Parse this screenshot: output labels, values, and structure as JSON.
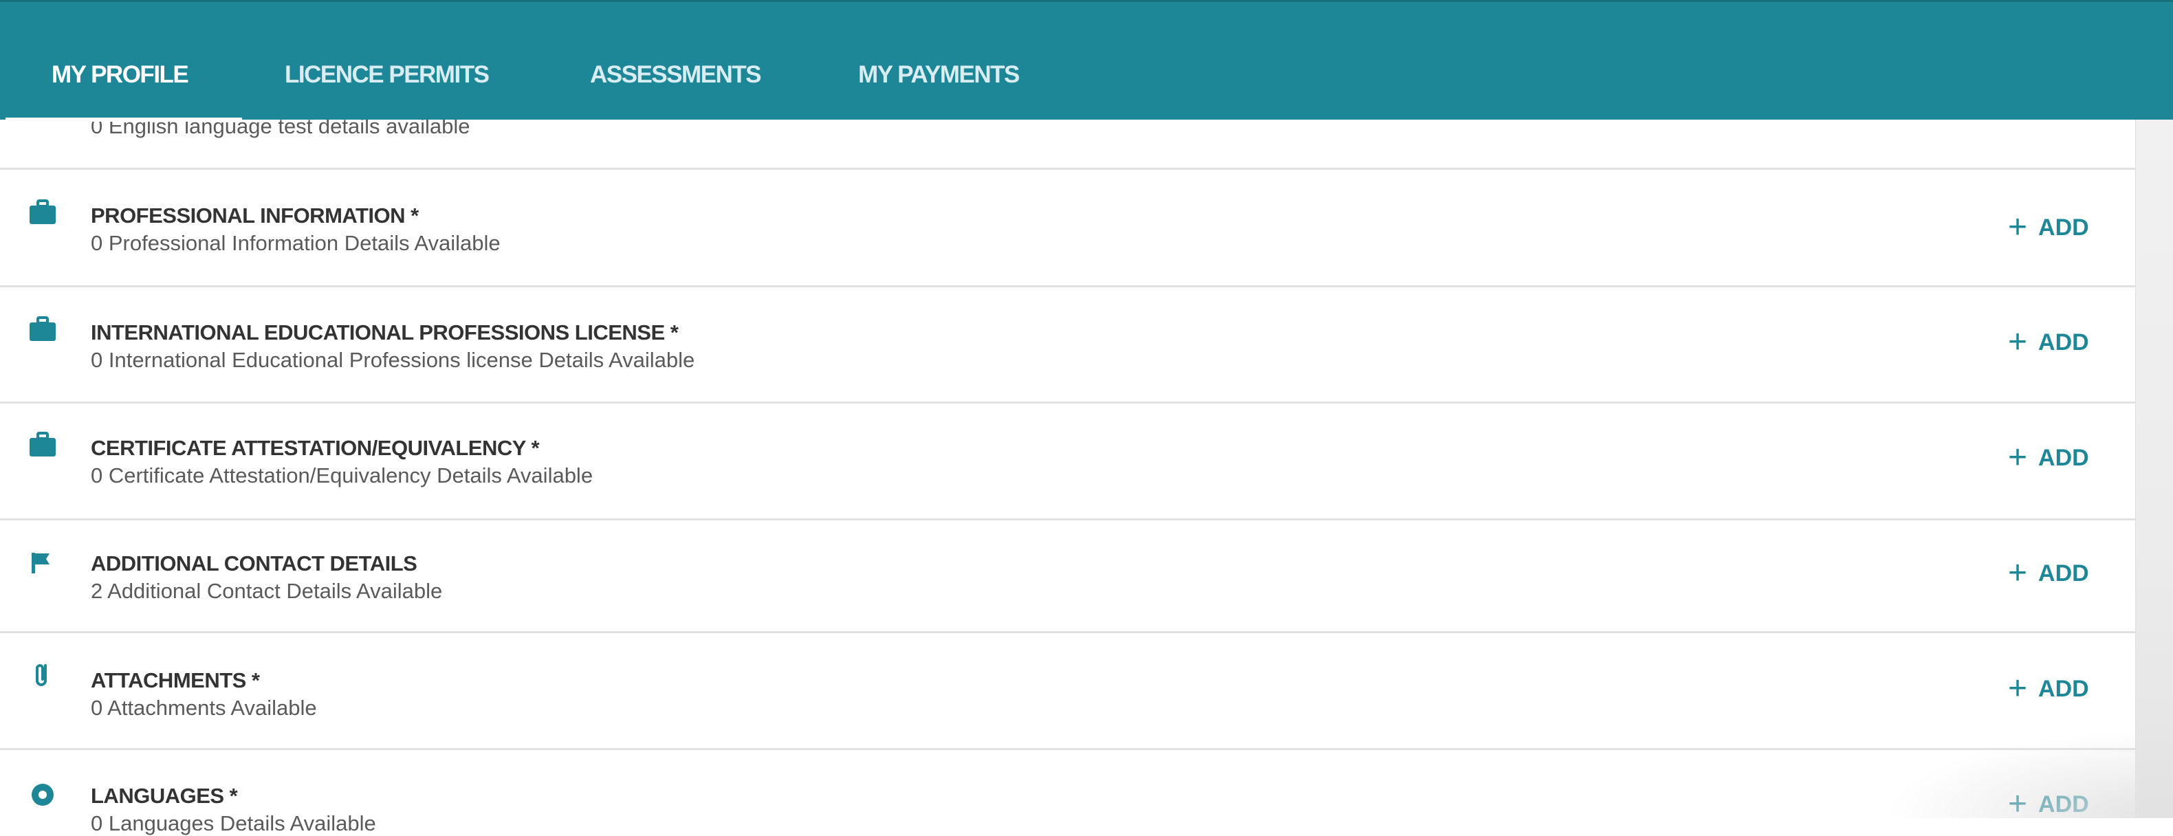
{
  "nav": {
    "tabs": [
      {
        "label": "MY PROFILE"
      },
      {
        "label": "LICENCE PERMITS"
      },
      {
        "label": "ASSESSMENTS"
      },
      {
        "label": "MY PAYMENTS"
      }
    ],
    "active_tab": "MY PROFILE"
  },
  "partial_section": {
    "subtitle": "0 English language test details available"
  },
  "sections": [
    {
      "title": "PROFESSIONAL INFORMATION *",
      "subtitle": "0 Professional Information Details Available",
      "icon": "briefcase-icon",
      "action": "ADD"
    },
    {
      "title": "INTERNATIONAL EDUCATIONAL PROFESSIONS LICENSE *",
      "subtitle": "0 International Educational Professions license Details Available",
      "icon": "briefcase-icon",
      "action": "ADD"
    },
    {
      "title": "CERTIFICATE ATTESTATION/EQUIVALENCY *",
      "subtitle": "0 Certificate Attestation/Equivalency Details Available",
      "icon": "briefcase-icon",
      "action": "ADD"
    },
    {
      "title": "ADDITIONAL CONTACT DETAILS",
      "subtitle": "2 Additional Contact Details Available",
      "icon": "flag-icon",
      "action": "ADD"
    },
    {
      "title": "ATTACHMENTS *",
      "subtitle": "0 Attachments Available",
      "icon": "paperclip-icon",
      "action": "ADD"
    },
    {
      "title": "LANGUAGES *",
      "subtitle": "0 Languages Details Available",
      "icon": "language-icon",
      "action": "ADD"
    }
  ],
  "add_plus_glyph": "+",
  "colors": {
    "header_bg": "#1e8797",
    "accent": "#1d8797",
    "title_text": "#333333",
    "subtitle_text": "#5a5a5a"
  }
}
